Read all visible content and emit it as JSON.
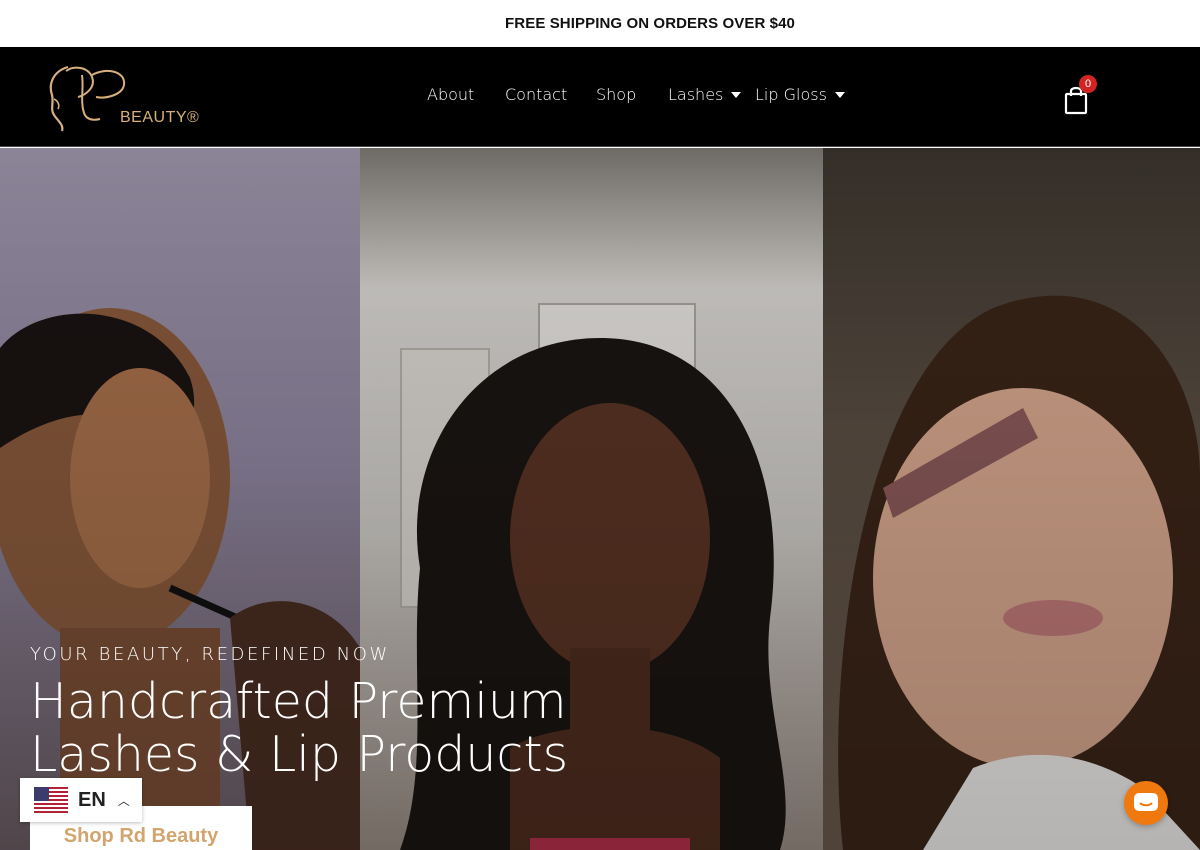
{
  "announcement": {
    "text": "FREE SHIPPING ON ORDERS OVER $40"
  },
  "brand": {
    "logo_text": "BEAUTY®"
  },
  "nav": {
    "items": [
      {
        "label": "About"
      },
      {
        "label": "Contact"
      },
      {
        "label": "Shop"
      },
      {
        "label": "Lashes",
        "has_dropdown": true
      },
      {
        "label": "Lip Gloss",
        "has_dropdown": true
      }
    ]
  },
  "cart": {
    "count": "0",
    "icon": "shopping-bag-icon"
  },
  "hero": {
    "eyebrow": "YOUR BEAUTY, REDEFINED NOW",
    "title_line1": "Handcrafted Premium",
    "title_line2": "Lashes & Lip Products",
    "cta_label": "Shop Rd Beauty"
  },
  "language": {
    "code": "EN",
    "icon": "us-flag-icon"
  },
  "chat": {
    "icon": "chat-icon"
  },
  "colors": {
    "accent": "#d2a56f",
    "badge": "#d32424",
    "chat": "#f0790f",
    "header_bg": "#000000"
  }
}
